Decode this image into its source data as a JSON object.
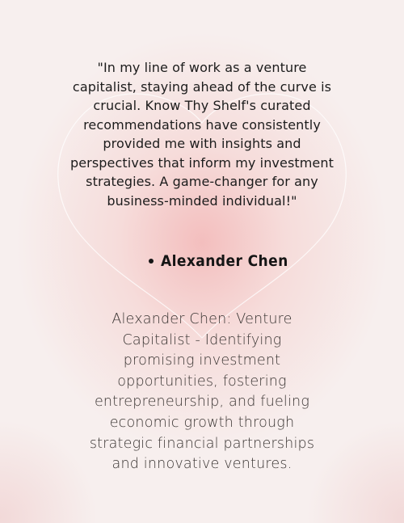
{
  "testimonial": {
    "quote": "\"In my line of work as a venture capitalist, staying ahead of the curve is crucial. Know Thy Shelf's curated recommendations have consistently provided me with insights and perspectives that inform my investment strategies. A game-changer for any business-minded individual!\"",
    "author": "Alexander Chen",
    "bio": "Alexander Chen: Venture Capitalist - Identifying promising investment opportunities, fostering entrepreneurship, and fueling economic growth through strategic financial partnerships and innovative ventures."
  },
  "colors": {
    "background": "#f7efee",
    "glow": "#f0a0a0",
    "heart_outline": "#ffffff",
    "text_dark": "#1c1c1c",
    "bio_text": "#3a3533"
  }
}
